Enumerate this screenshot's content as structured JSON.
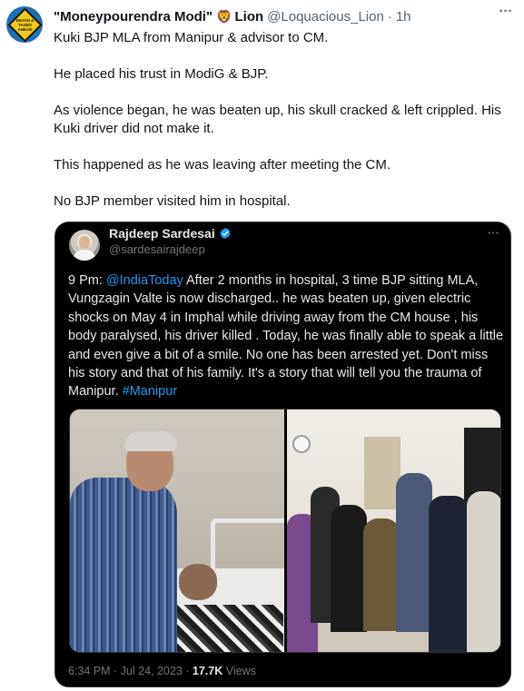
{
  "tweet": {
    "avatar_text": "DEATH & TAXES AHEAD",
    "display_name": "\"Moneypourendra Modi\"",
    "name_emoji": "🦁",
    "name_suffix": "Lion",
    "handle": "@Loquacious_Lion",
    "separator": "·",
    "time": "1h",
    "more_icon": "more-horizontal-icon",
    "paragraphs": [
      "Kuki BJP MLA from Manipur & advisor to CM.",
      "He placed his trust in ModiG & BJP.",
      "As violence began, he was beaten up, his skull cracked & left crippled. His Kuki driver did not make it.",
      "This happened as he was leaving after meeting the CM.",
      "No BJP member visited him in hospital."
    ]
  },
  "quote": {
    "display_name": "Rajdeep Sardesai",
    "verified_icon": "verified-badge-icon",
    "handle": "@sardesairajdeep",
    "text_prefix": "9 Pm: ",
    "mention": "@IndiaToday",
    "text_main": " After 2 months in hospital, 3 time BJP sitting MLA, Vungzagin Valte is now discharged.. he was beaten up, given electric shocks on May 4 in Imphal while driving away from the CM house , his body paralysed, his driver killed . Today, he was finally able to speak a little and even give a bit of a smile. No one has been arrested yet. Don't miss his story and that of his family. It's a story that will tell you the trauma of Manipur. ",
    "hashtag": "#Manipur",
    "timestamp": "6:34 PM · Jul 24, 2023",
    "meta_separator": " · ",
    "views_count": "17.7K",
    "views_label": " Views"
  },
  "colors": {
    "link": "#1d9bf0",
    "secondary_text": "#536471",
    "quote_bg": "#000000"
  }
}
